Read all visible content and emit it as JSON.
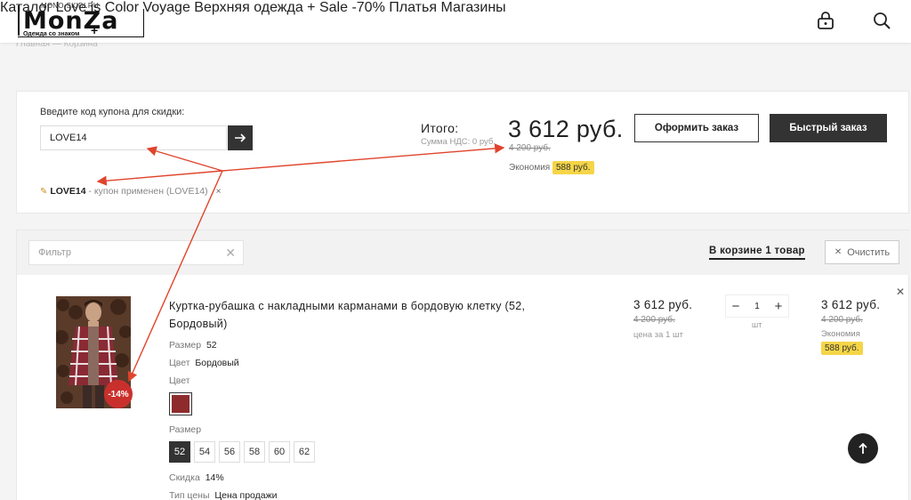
{
  "header": {
    "logo": {
      "url_text": "MONO-SKIDI.RU",
      "wordmark": "MonZa",
      "tagline": "Одежда со знаком"
    },
    "nav": [
      "Каталог",
      "Love is",
      "Color Voyage",
      "Верхняя одежда +",
      "Sale -70%",
      "Платья",
      "Магазины"
    ],
    "icons": [
      "lock-icon",
      "search-icon"
    ]
  },
  "breadcrumb": "Главная — Корзина",
  "coupon": {
    "label": "Введите код купона для скидки:",
    "value": "LOVE14",
    "applied_code": "LOVE14",
    "applied_text": " - купон применен (LOVE14)",
    "remove": "×"
  },
  "summary": {
    "total_label": "Итого:",
    "vat": "Сумма НДС: 0 руб.",
    "total": "3 612 руб.",
    "old_total": "4 200 руб.",
    "economy_label": "Экономия",
    "economy": "588 руб.",
    "order_btn": "Оформить заказ",
    "quick_btn": "Быстрый заказ"
  },
  "cart": {
    "filter_placeholder": "Фильтр",
    "count_label": "В корзине 1 товар",
    "clear_btn": "Очистить",
    "item": {
      "name": "Куртка-рубашка с накладными карманами в бордовую клетку (52, Бордовый)",
      "size_label": "Размер",
      "size_value": "52",
      "color_label": "Цвет",
      "color_value": "Бордовый",
      "color_label2": "Цвет",
      "size_label2": "Размер",
      "sizes": [
        "52",
        "54",
        "56",
        "58",
        "60",
        "62"
      ],
      "selected_size": "52",
      "discount_label": "Скидка",
      "discount_value": "14%",
      "price_type_label": "Тип цены",
      "price_type_value": "Цена продажи",
      "badge": "-14%",
      "price": "3 612 руб.",
      "price_old": "4 200 руб.",
      "per_unit": "цена за 1 шт",
      "qty": "1",
      "unit": "шт",
      "sum": "3 612 руб.",
      "sum_old": "4 200 руб.",
      "sum_econ_label": "Экономия",
      "sum_econ": "588 руб.",
      "swatch_color": "#8e2b2c"
    }
  },
  "colors": {
    "accent": "#333333",
    "badge": "#f5d547",
    "discount": "#c9302c",
    "annotation": "#e0442c"
  }
}
